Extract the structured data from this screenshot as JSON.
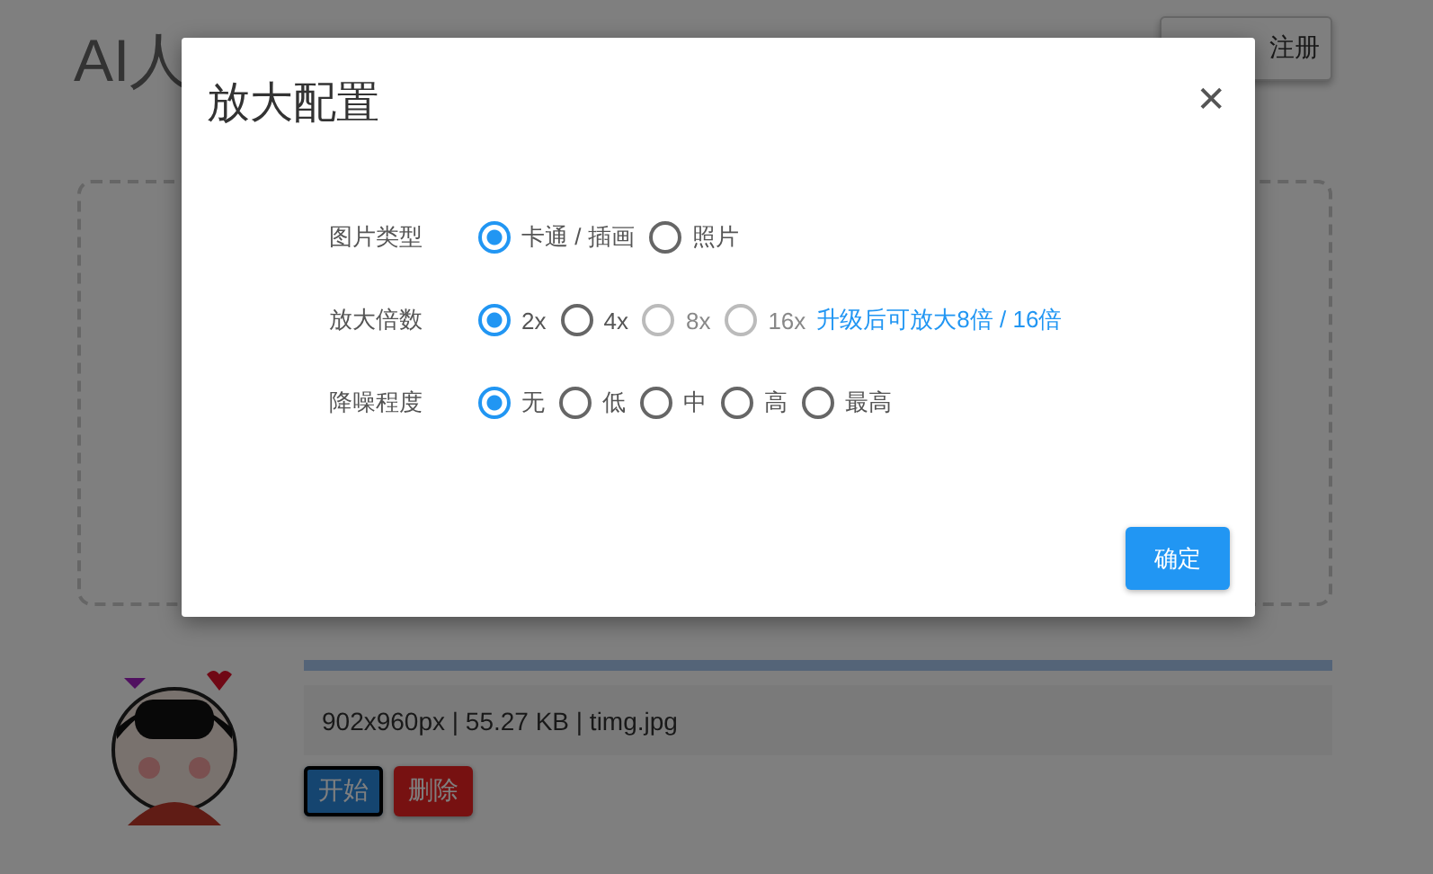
{
  "page": {
    "title": "AI人",
    "account_button": "注册",
    "file": {
      "progress": {
        "level": 1
      },
      "info": "902x960px | 55.27 KB | timg.jpg",
      "buttons": [
        {
          "label": "开始",
          "kind": "primary",
          "focused": true
        },
        {
          "label": "删除",
          "kind": "danger",
          "focused": false
        }
      ]
    }
  },
  "dialog": {
    "title": "放大配置",
    "close": "✕",
    "rows": [
      {
        "label": "图片类型",
        "options": [
          {
            "label": "卡通 / 插画",
            "selected": true,
            "disabled": false
          },
          {
            "label": "照片",
            "selected": false,
            "disabled": false
          }
        ]
      },
      {
        "label": "放大倍数",
        "options": [
          {
            "label": "2x",
            "selected": true,
            "disabled": false
          },
          {
            "label": "4x",
            "selected": false,
            "disabled": false
          },
          {
            "label": "8x",
            "selected": false,
            "disabled": true
          },
          {
            "label": "16x",
            "selected": false,
            "disabled": true
          }
        ],
        "hint": "升级后可放大8倍 / 16倍"
      },
      {
        "label": "降噪程度",
        "options": [
          {
            "label": "无",
            "selected": true,
            "disabled": false
          },
          {
            "label": "低",
            "selected": false,
            "disabled": false
          },
          {
            "label": "中",
            "selected": false,
            "disabled": false
          },
          {
            "label": "高",
            "selected": false,
            "disabled": false
          },
          {
            "label": "最高",
            "selected": false,
            "disabled": false
          }
        ]
      }
    ],
    "confirm": "确定"
  }
}
